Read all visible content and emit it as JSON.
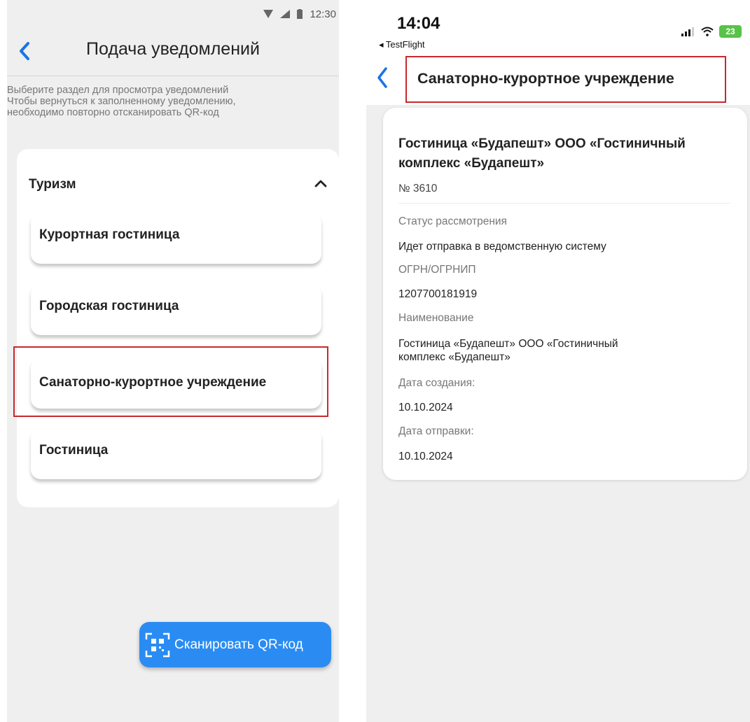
{
  "colors": {
    "accent": "#2a8cf2",
    "highlight": "#c8282d",
    "battery": "#58c24a"
  },
  "left": {
    "status_bar": {
      "time": "12:30",
      "icons": [
        "wifi-icon",
        "signal-icon",
        "battery-icon"
      ]
    },
    "header": {
      "title": "Подача уведомлений",
      "back_icon": "chevron-left-icon"
    },
    "hint_lines": [
      "Выберите раздел для просмотра уведомлений",
      "Чтобы вернуться к заполненному уведомлению,",
      "необходимо повторно отсканировать QR-код"
    ],
    "group": {
      "title": "Туризм",
      "toggle_icon": "chevron-up-icon",
      "items": [
        {
          "label": "Курортная гостиница"
        },
        {
          "label": "Городская гостиница"
        },
        {
          "label": "Санаторно-курортное учреждение"
        },
        {
          "label": "Гостиница"
        }
      ]
    },
    "scan_button": {
      "label": "Сканировать QR-код",
      "icon": "qr-code-icon"
    }
  },
  "right": {
    "status_bar": {
      "time": "14:04",
      "back_app": "◂ TestFlight",
      "battery": "23",
      "icons": [
        "signal-icon",
        "wifi-icon",
        "battery-icon"
      ]
    },
    "header": {
      "title": "Санаторно-курортное учреждение",
      "back_icon": "chevron-left-icon"
    },
    "card": {
      "org_name": "Гостиница «Будапешт» ООО «Гостиничный комплекс «Будапешт»",
      "number": "№ 3610",
      "fields": [
        {
          "label": "Статус рассмотрения",
          "value": "Идет отправка в ведомственную систему"
        },
        {
          "label": "ОГРН/ОГРНИП",
          "value": "1207700181919"
        },
        {
          "label": "Наименование",
          "value_lines": [
            "Гостиница «Будапешт» ООО «Гостиничный",
            "комплекс «Будапешт»"
          ]
        },
        {
          "label": "Дата создания:",
          "value": "10.10.2024"
        },
        {
          "label": "Дата отправки:",
          "value": "10.10.2024"
        }
      ]
    }
  }
}
